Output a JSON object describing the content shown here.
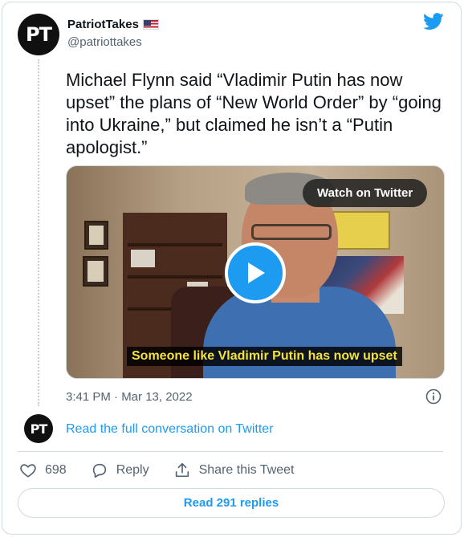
{
  "author": {
    "name": "PatriotTakes",
    "handle": "@patriottakes",
    "avatar_text": "PT",
    "flag_icon": "us-flag-icon"
  },
  "brand_icon": "twitter-bird-icon",
  "tweet": {
    "text": "Michael Flynn said “Vladimir Putin has now upset” the plans of “New World Order” by “going into Ukraine,” but claimed he isn’t a “Putin apologist.”",
    "timestamp": "3:41 PM · Mar 13, 2022"
  },
  "media": {
    "watch_label": "Watch on Twitter",
    "subtitle": "Someone like Vladimir Putin has now upset",
    "play_icon": "play-icon"
  },
  "conversation": {
    "avatar_text": "PT",
    "link_text": "Read the full conversation on Twitter"
  },
  "actions": {
    "like_count": "698",
    "reply_label": "Reply",
    "share_label": "Share this Tweet"
  },
  "replies_button": "Read 291 replies",
  "colors": {
    "accent": "#1d9bf0",
    "text": "#0f1419",
    "muted": "#536471",
    "border": "#cfd9de"
  }
}
